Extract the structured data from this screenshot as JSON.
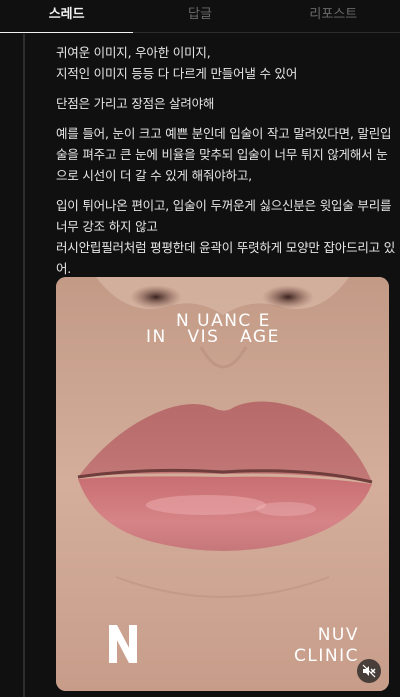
{
  "tabs": [
    {
      "label": "스레드",
      "active": true
    },
    {
      "label": "답글",
      "active": false
    },
    {
      "label": "리포스트",
      "active": false
    }
  ],
  "post": {
    "paragraphs": [
      "귀여운 이미지, 우아한 이미지,\n지적인 이미지 등등 다 다르게 만들어낼 수 있어",
      "단점은 가리고 장점은 살려야해",
      "예를 들어, 눈이 크고 예쁜 분인데 입술이 작고 말려있다면, 말린입술을 펴주고 큰 눈에 비율을 맞추되 입술이 너무 튀지 않게해서 눈으로 시선이 더 갈 수 있게 해줘야하고,",
      "입이 튀어나온 편이고, 입술이 두꺼운게 싫으신분은 윗입술 부리를 너무 강조 하지 않고\n러시안립필러처럼 평평한데 윤곽이 뚜렷하게 모양만 잡아드리고 있어."
    ]
  },
  "media": {
    "logo_line1": "N UANC E",
    "logo_line2": "IN   VIS   AGE",
    "mark": "N",
    "clinic_line1": "NUV",
    "clinic_line2": "CLINIC",
    "mute_icon": "speaker-muted-icon"
  },
  "colors": {
    "background": "#101010",
    "text": "#e6e6e6",
    "tab_inactive": "#6a6a6a",
    "lip": "#c9716f"
  }
}
